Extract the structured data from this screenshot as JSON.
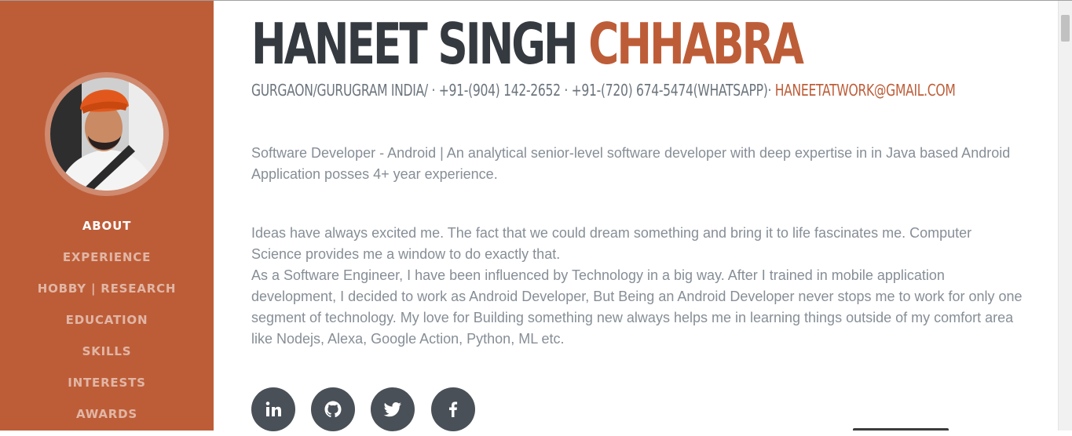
{
  "profile": {
    "first_name": "HANEET SINGH",
    "last_name": "CHHABRA",
    "contact_text": "GURGAON/GURUGRAM INDIA/ · +91-(904) 142-2652 · +91-(720) 674-5474(WHATSAPP)· ",
    "email": "HANEETATWORK@GMAIL.COM"
  },
  "nav": {
    "items": [
      {
        "label": "ABOUT"
      },
      {
        "label": "EXPERIENCE"
      },
      {
        "label": "HOBBY | RESEARCH"
      },
      {
        "label": "EDUCATION"
      },
      {
        "label": "SKILLS"
      },
      {
        "label": "INTERESTS"
      },
      {
        "label": "AWARDS"
      }
    ]
  },
  "about": {
    "summary": "Software Developer - Android | An analytical senior-level software developer with deep expertise in in Java based Android Application posses 4+ year experience.",
    "bio_line1": "Ideas have always excited me. The fact that we could dream something and bring it to life fascinates me. Computer Science provides me a window to do exactly that.",
    "bio_line2": "As a Software Engineer, I have been influenced by Technology in a big way. After I trained in mobile application development, I decided to work as Android Developer, But Being an Android Developer never stops me to work for only one segment of technology. My love for Building something new always helps me in learning things outside of my comfort area like Nodejs, Alexa, Google Action, Python, ML etc."
  },
  "social": {
    "icons": [
      "linkedin-icon",
      "github-icon",
      "twitter-icon",
      "facebook-icon"
    ]
  },
  "colors": {
    "accent": "#bd5d38",
    "heading": "#343a40",
    "body_text": "#868e96",
    "social_bg": "#495057"
  }
}
